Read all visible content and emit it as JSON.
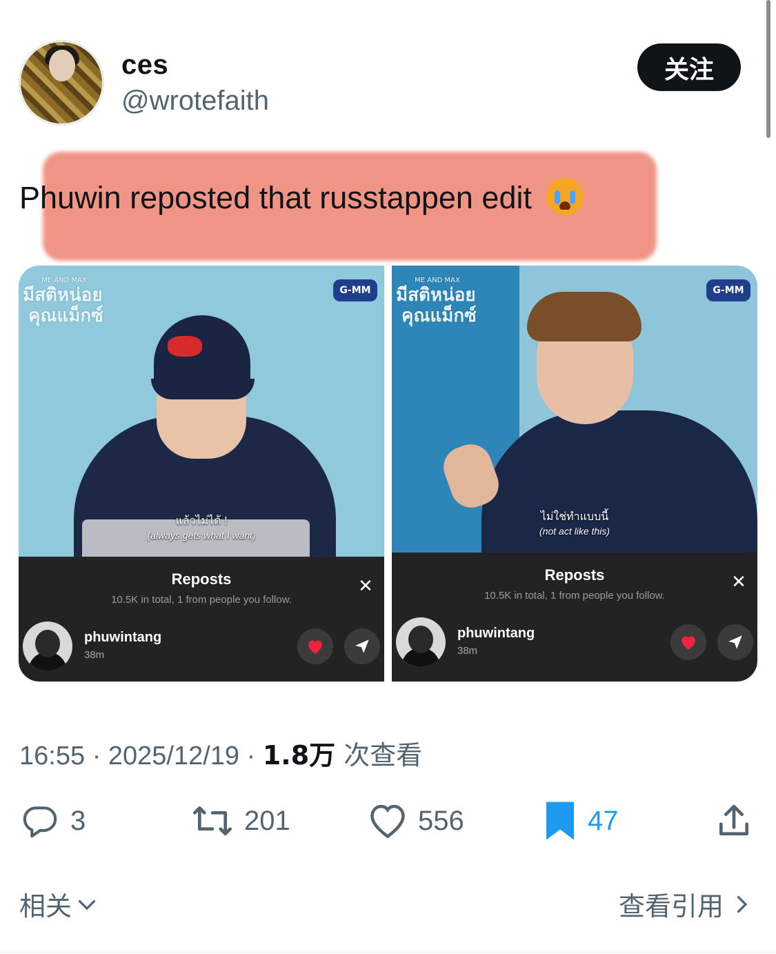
{
  "author": {
    "display_name": "ces",
    "handle": "@wrotefaith",
    "follow_label": "关注"
  },
  "tweet": {
    "text": "Phuwin reposted that russtappen edit",
    "emoji": "crying-face"
  },
  "media": [
    {
      "show_title_small": "ME AND MAX",
      "show_title_line1": "มีสติหน่อย",
      "show_title_line2": "คุณแม็กซ์",
      "channel_logo": "G-MM",
      "subtitle_th": "แล้วไม่ได้ !",
      "subtitle_en": "(always gets what I want)",
      "sheet_title": "Reposts",
      "sheet_sub": "10.5K in total, 1 from people you follow.",
      "repost_user": "phuwintang",
      "repost_time": "38m"
    },
    {
      "show_title_small": "ME AND MAX",
      "show_title_line1": "มีสติหน่อย",
      "show_title_line2": "คุณแม็กซ์",
      "channel_logo": "G-MM",
      "subtitle_th": "ไม่ใช่ทำแบบนี้",
      "subtitle_en": "(not act like this)",
      "sheet_title": "Reposts",
      "sheet_sub": "10.5K in total, 1 from people you follow.",
      "repost_user": "phuwintang",
      "repost_time": "38m"
    }
  ],
  "meta": {
    "time": "16:55",
    "sep1": " · ",
    "date": "2025/12/19",
    "sep2": " · ",
    "views_count": "1.8万",
    "views_label": " 次查看"
  },
  "actions": {
    "replies": "3",
    "retweets": "201",
    "likes": "556",
    "bookmarks": "47"
  },
  "footer": {
    "related_label": "相关",
    "view_quotes_label": "查看引用"
  },
  "colors": {
    "text": "#0f1419",
    "secondary": "#536471",
    "accent": "#1d9bf0",
    "highlight": "#ef8a78"
  }
}
